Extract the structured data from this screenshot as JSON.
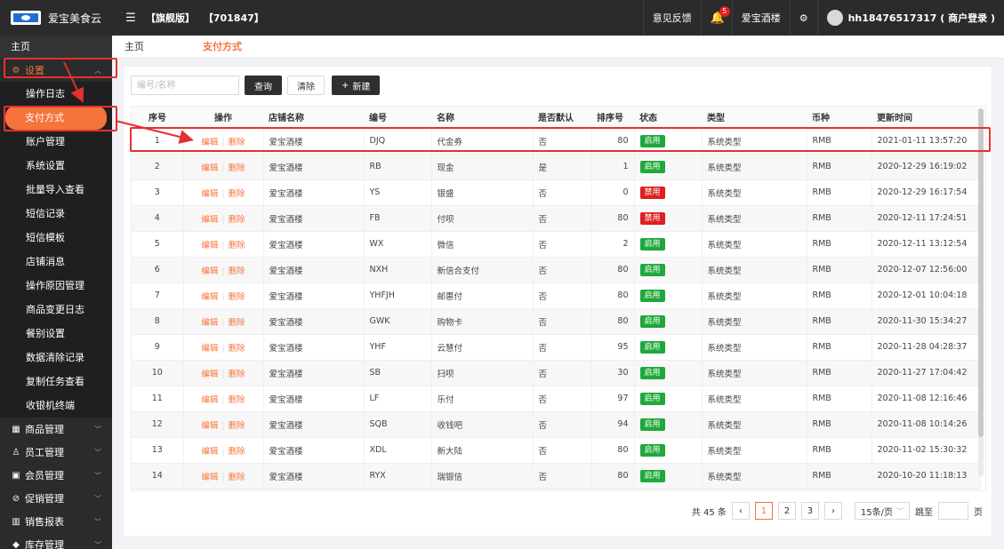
{
  "app": {
    "title": "爱宝美食云",
    "edition": "【旗舰版】",
    "account_id": "【701847】"
  },
  "top": {
    "feedback": "意见反馈",
    "notifications": "5",
    "store": "爱宝酒楼",
    "user": "hh18476517317 ( 商户登录 )"
  },
  "sidebar": {
    "home": "主页",
    "settings": "设置",
    "items": [
      "操作日志",
      "支付方式",
      "账户管理",
      "系统设置",
      "批量导入查看",
      "短信记录",
      "短信模板",
      "店铺消息",
      "操作原因管理",
      "商品变更日志",
      "餐别设置",
      "数据清除记录",
      "复制任务查看",
      "收银机终端"
    ],
    "groups": [
      "商品管理",
      "员工管理",
      "会员管理",
      "促销管理",
      "销售报表",
      "库存管理"
    ]
  },
  "tabs": {
    "home": "主页",
    "current": "支付方式"
  },
  "toolbar": {
    "search_placeholder": "编号/名称",
    "query": "查询",
    "clear": "清除",
    "new": "新建"
  },
  "table": {
    "columns": [
      "序号",
      "操作",
      "店铺名称",
      "编号",
      "名称",
      "是否默认",
      "排序号",
      "状态",
      "类型",
      "币种",
      "更新时间"
    ],
    "edit_label": "编辑",
    "delete_label": "删除",
    "rows": [
      [
        "1",
        "爱宝酒楼",
        "DJQ",
        "代金券",
        "否",
        "80",
        "启用",
        "系统类型",
        "RMB",
        "2021-01-11 13:57:20"
      ],
      [
        "2",
        "爱宝酒楼",
        "RB",
        "现金",
        "是",
        "1",
        "启用",
        "系统类型",
        "RMB",
        "2020-12-29 16:19:02"
      ],
      [
        "3",
        "爱宝酒楼",
        "YS",
        "银盛",
        "否",
        "0",
        "禁用",
        "系统类型",
        "RMB",
        "2020-12-29 16:17:54"
      ],
      [
        "4",
        "爱宝酒楼",
        "FB",
        "付呗",
        "否",
        "80",
        "禁用",
        "系统类型",
        "RMB",
        "2020-12-11 17:24:51"
      ],
      [
        "5",
        "爱宝酒楼",
        "WX",
        "微信",
        "否",
        "2",
        "启用",
        "系统类型",
        "RMB",
        "2020-12-11 13:12:54"
      ],
      [
        "6",
        "爱宝酒楼",
        "NXH",
        "新信合支付",
        "否",
        "80",
        "启用",
        "系统类型",
        "RMB",
        "2020-12-07 12:56:00"
      ],
      [
        "7",
        "爱宝酒楼",
        "YHFJH",
        "邮惠付",
        "否",
        "80",
        "启用",
        "系统类型",
        "RMB",
        "2020-12-01 10:04:18"
      ],
      [
        "8",
        "爱宝酒楼",
        "GWK",
        "购物卡",
        "否",
        "80",
        "启用",
        "系统类型",
        "RMB",
        "2020-11-30 15:34:27"
      ],
      [
        "9",
        "爱宝酒楼",
        "YHF",
        "云慧付",
        "否",
        "95",
        "启用",
        "系统类型",
        "RMB",
        "2020-11-28 04:28:37"
      ],
      [
        "10",
        "爱宝酒楼",
        "SB",
        "扫呗",
        "否",
        "30",
        "启用",
        "系统类型",
        "RMB",
        "2020-11-27 17:04:42"
      ],
      [
        "11",
        "爱宝酒楼",
        "LF",
        "乐付",
        "否",
        "97",
        "启用",
        "系统类型",
        "RMB",
        "2020-11-08 12:16:46"
      ],
      [
        "12",
        "爱宝酒楼",
        "SQB",
        "收钱吧",
        "否",
        "94",
        "启用",
        "系统类型",
        "RMB",
        "2020-11-08 10:14:26"
      ],
      [
        "13",
        "爱宝酒楼",
        "XDL",
        "新大陆",
        "否",
        "80",
        "启用",
        "系统类型",
        "RMB",
        "2020-11-02 15:30:32"
      ],
      [
        "14",
        "爱宝酒楼",
        "RYX",
        "瑞银信",
        "否",
        "80",
        "启用",
        "系统类型",
        "RMB",
        "2020-10-20 11:18:13"
      ]
    ]
  },
  "pager": {
    "total": "共 45 条",
    "pages": [
      "1",
      "2",
      "3"
    ],
    "current": "1",
    "page_size": "15条/页",
    "jump_label": "跳至",
    "page_unit": "页"
  },
  "colors": {
    "accent": "#f5743b",
    "enabled": "#1fa83b",
    "disabled": "#e02020",
    "annotation": "#e53030",
    "dark": "#2b2b2b"
  }
}
